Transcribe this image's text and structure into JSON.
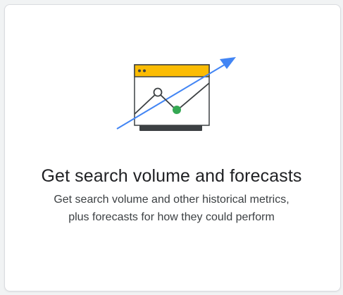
{
  "card": {
    "title": "Get search volume and forecasts",
    "description_lines": [
      "Get search volume and other historical metrics,",
      "plus forecasts for how they could perform"
    ],
    "illustration_icon": "forecast-chart-icon"
  },
  "colors": {
    "window_header": "#fbbc04",
    "window_body": "#ffffff",
    "window_outline": "#3c4043",
    "window_base": "#3c4043",
    "trend_arrow": "#4285f4",
    "chart_line": "#3c4043",
    "highlight_point": "#34a853",
    "text_primary": "#202124",
    "text_secondary": "#3c4043",
    "card_border": "#dadce0"
  }
}
